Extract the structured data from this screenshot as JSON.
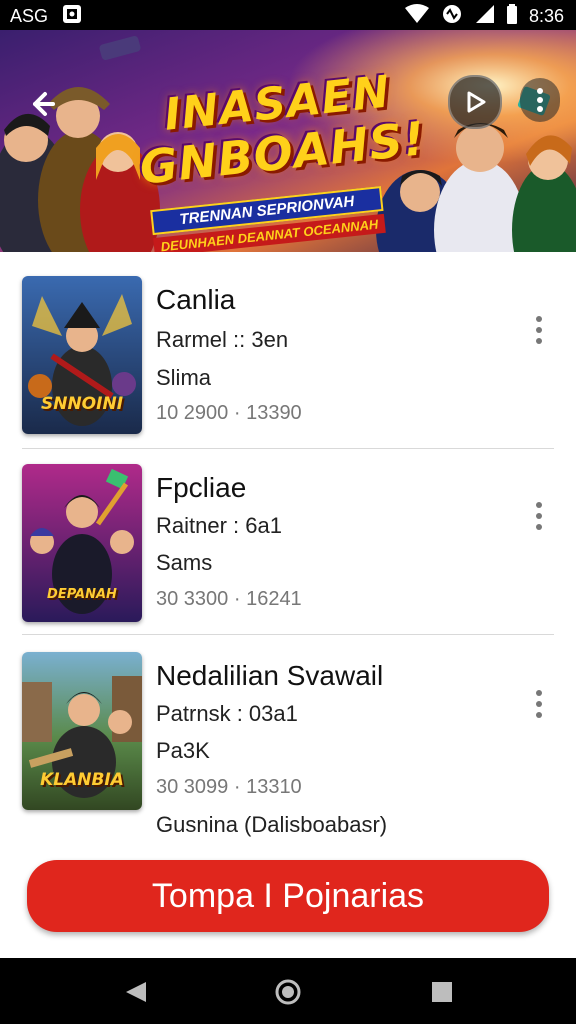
{
  "status_bar": {
    "carrier": "ASG",
    "time": "8:36",
    "icons": [
      "photo-icon",
      "wifi-icon",
      "vibrate-icon",
      "signal-icon",
      "battery-icon"
    ]
  },
  "banner": {
    "title_line1": "INASAEN",
    "title_line2": "GNBOAHS!",
    "subtitle_line1": "TRENNAN SEPRIONVAH",
    "subtitle_line2": "DEUNHAEN DEANNAT OCEANNAH",
    "icons": [
      "back-arrow-icon",
      "play-icon",
      "more-vertical-icon"
    ]
  },
  "games": [
    {
      "title": "Canlia",
      "line1": "Rarmel :: 3en",
      "line2": "Slima",
      "code": "10 2900 · 13390",
      "thumb_label": "SNNOINI",
      "extra": ""
    },
    {
      "title": "Fpcliae",
      "line1": "Raitner : 6a1",
      "line2": "Sams",
      "code": "30 3300 · 16241",
      "thumb_label": "DEPANAH",
      "extra": ""
    },
    {
      "title": "Nedalilian Svawail",
      "line1": "Patrnsk : 03a1",
      "line2": "Pa3K",
      "code": "30 3099 · 13310",
      "thumb_label": "KLANBIA",
      "extra": "Gusnina (Dalisboabasr)"
    }
  ],
  "cta": {
    "label": "Tompa I Pojnarias"
  },
  "colors": {
    "accent": "#e0261d",
    "status_bar": "#000000",
    "title_yellow": "#ffd11a",
    "subtitle_blue": "#1a2fa0"
  }
}
